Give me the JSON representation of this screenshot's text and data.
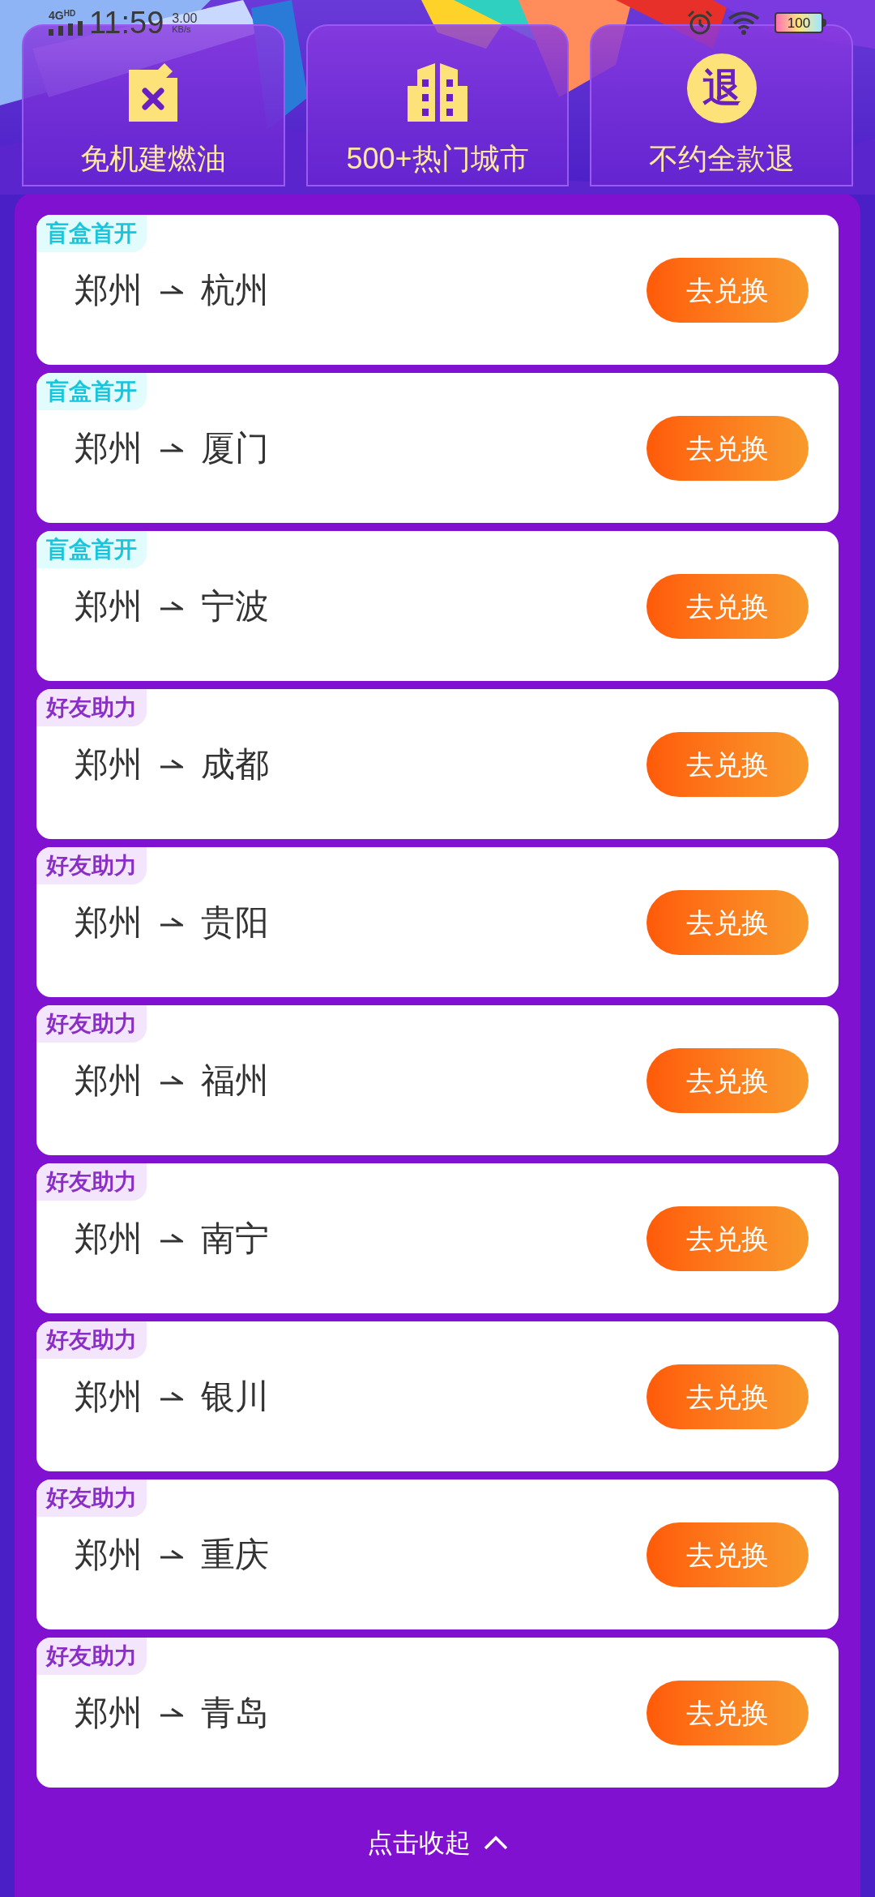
{
  "status_bar": {
    "network": "4G",
    "network_badge": "HD",
    "time": "11:59",
    "speed_value": "3.00",
    "speed_unit": "KB/s",
    "battery": "100"
  },
  "features": [
    {
      "kind": "fuel",
      "label": "免机建燃油"
    },
    {
      "kind": "building",
      "label": "500+热门城市"
    },
    {
      "kind": "refund",
      "icon_text": "退",
      "label": "不约全款退"
    }
  ],
  "routes": [
    {
      "tag": "盲盒首开",
      "kind": "blindbox",
      "from": "郑州",
      "to": "杭州",
      "button": "去兑换"
    },
    {
      "tag": "盲盒首开",
      "kind": "blindbox",
      "from": "郑州",
      "to": "厦门",
      "button": "去兑换"
    },
    {
      "tag": "盲盒首开",
      "kind": "blindbox",
      "from": "郑州",
      "to": "宁波",
      "button": "去兑换"
    },
    {
      "tag": "好友助力",
      "kind": "friend",
      "from": "郑州",
      "to": "成都",
      "button": "去兑换"
    },
    {
      "tag": "好友助力",
      "kind": "friend",
      "from": "郑州",
      "to": "贵阳",
      "button": "去兑换"
    },
    {
      "tag": "好友助力",
      "kind": "friend",
      "from": "郑州",
      "to": "福州",
      "button": "去兑换"
    },
    {
      "tag": "好友助力",
      "kind": "friend",
      "from": "郑州",
      "to": "南宁",
      "button": "去兑换"
    },
    {
      "tag": "好友助力",
      "kind": "friend",
      "from": "郑州",
      "to": "银川",
      "button": "去兑换"
    },
    {
      "tag": "好友助力",
      "kind": "friend",
      "from": "郑州",
      "to": "重庆",
      "button": "去兑换"
    },
    {
      "tag": "好友助力",
      "kind": "friend",
      "from": "郑州",
      "to": "青岛",
      "button": "去兑换"
    }
  ],
  "collapse": {
    "label": "点击收起"
  }
}
